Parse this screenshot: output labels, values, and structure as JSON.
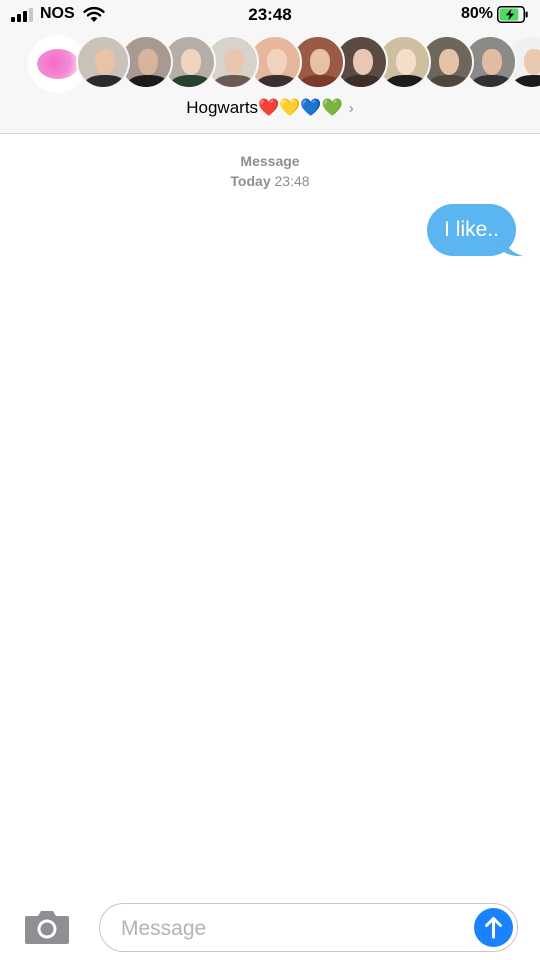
{
  "status_bar": {
    "carrier": "NOS",
    "time": "23:48",
    "battery_percent": "80%",
    "signal_bars_filled": 3,
    "signal_bars_total": 4,
    "charging": true,
    "icons": [
      "signal-bars-icon",
      "wifi-icon",
      "battery-charging-icon"
    ]
  },
  "header": {
    "group_name": "Hogwarts❤️💛💙💚",
    "chevron": "›",
    "avatars": [
      {
        "name": "avatar-group-pink",
        "skin": "#f6c9d8",
        "robe": "#f37dc8",
        "bg": "#ffffff"
      },
      {
        "name": "avatar-member-1",
        "skin": "#e8c3a6",
        "robe": "#2d2a2c",
        "bg": "#c9c2b8"
      },
      {
        "name": "avatar-member-2",
        "skin": "#d9b49c",
        "robe": "#1d1a1b",
        "bg": "#a79b91"
      },
      {
        "name": "avatar-member-3",
        "skin": "#efd5c0",
        "robe": "#264230",
        "bg": "#b6aea6"
      },
      {
        "name": "avatar-member-4",
        "skin": "#e9c6ae",
        "robe": "#6a5a52",
        "bg": "#d7d2cc"
      },
      {
        "name": "avatar-member-5",
        "skin": "#f1d4bf",
        "robe": "#3a3030",
        "bg": "#e6b79c"
      },
      {
        "name": "avatar-member-6",
        "skin": "#e7c0a6",
        "robe": "#7b3b2a",
        "bg": "#9a5a45"
      },
      {
        "name": "avatar-member-7",
        "skin": "#e8c8b4",
        "robe": "#3e2e28",
        "bg": "#5b4a42"
      },
      {
        "name": "avatar-member-8",
        "skin": "#f3dec7",
        "robe": "#1f1c1e",
        "bg": "#cdbf9f"
      },
      {
        "name": "avatar-member-9",
        "skin": "#e6c2a6",
        "robe": "#4c463e",
        "bg": "#6e655c"
      },
      {
        "name": "avatar-member-10",
        "skin": "#e2bca2",
        "robe": "#2e3234",
        "bg": "#8c8a86"
      },
      {
        "name": "avatar-member-11",
        "skin": "#e9c9b0",
        "robe": "#1c1c1f",
        "bg": "#f0f0f0"
      }
    ]
  },
  "thread": {
    "service_label": "Message",
    "timestamp_day": "Today",
    "timestamp_time": "23:48",
    "messages": [
      {
        "direction": "outgoing",
        "text": "I like.."
      }
    ]
  },
  "composer": {
    "placeholder": "Message",
    "value": ""
  },
  "colors": {
    "bubble_outgoing": "#5ab5f0",
    "send_button": "#1a82fb",
    "meta_text": "#8e8e93",
    "header_bg": "#f7f7f7",
    "battery_fill": "#4cd964"
  }
}
